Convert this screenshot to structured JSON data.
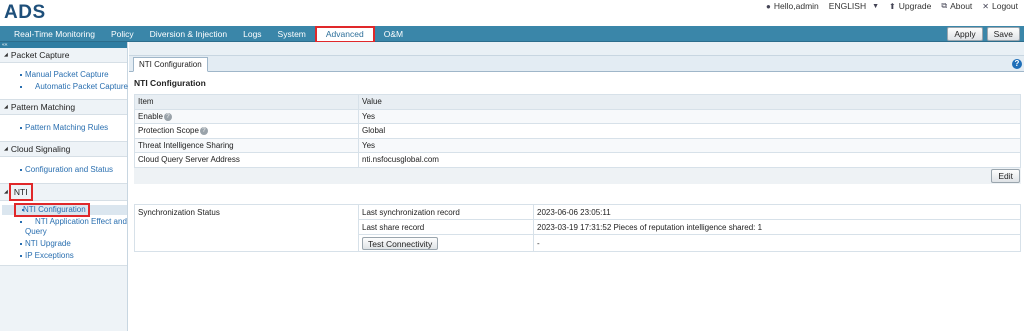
{
  "app": {
    "logo": "ADS"
  },
  "userbar": {
    "hello": "Hello,admin",
    "language": "ENGLISH",
    "upgrade": "Upgrade",
    "about": "About",
    "logout": "Logout"
  },
  "nav": {
    "items": [
      "Real-Time Monitoring",
      "Policy",
      "Diversion & Injection",
      "Logs",
      "System",
      "Advanced",
      "O&M"
    ],
    "apply": "Apply",
    "save": "Save"
  },
  "sidebar": {
    "collapse": "««",
    "sections": [
      {
        "title": "Packet Capture",
        "links": [
          "Manual Packet Capture",
          "Automatic Packet Capture"
        ]
      },
      {
        "title": "Pattern Matching",
        "links": [
          "Pattern Matching Rules"
        ]
      },
      {
        "title": "Cloud Signaling",
        "links": [
          "Configuration and Status"
        ]
      },
      {
        "title": "NTI",
        "links": [
          "NTI Configuration",
          "NTI Application Effect and Query",
          "NTI Upgrade",
          "IP Exceptions"
        ]
      }
    ]
  },
  "main": {
    "tab": "NTI Configuration",
    "help": "?",
    "section_title": "NTI Configuration",
    "table": {
      "headers": [
        "Item",
        "Value"
      ],
      "rows": [
        {
          "item": "Enable",
          "value": "Yes",
          "help": true
        },
        {
          "item": "Protection Scope",
          "value": "Global",
          "help": true
        },
        {
          "item": "Threat Intelligence Sharing",
          "value": "Yes",
          "help": false
        },
        {
          "item": "Cloud Query Server Address",
          "value": "nti.nsfocusglobal.com",
          "help": false
        }
      ]
    },
    "edit": "Edit",
    "sync": {
      "label": "Synchronization Status",
      "last_sync_label": "Last synchronization record",
      "last_sync_value": "2023-06-06 23:05:11",
      "last_share_label": "Last share record",
      "last_share_value": "2023-03-19 17:31:52 Pieces of reputation intelligence shared: 1",
      "test_button": "Test Connectivity",
      "test_value": "-"
    }
  }
}
